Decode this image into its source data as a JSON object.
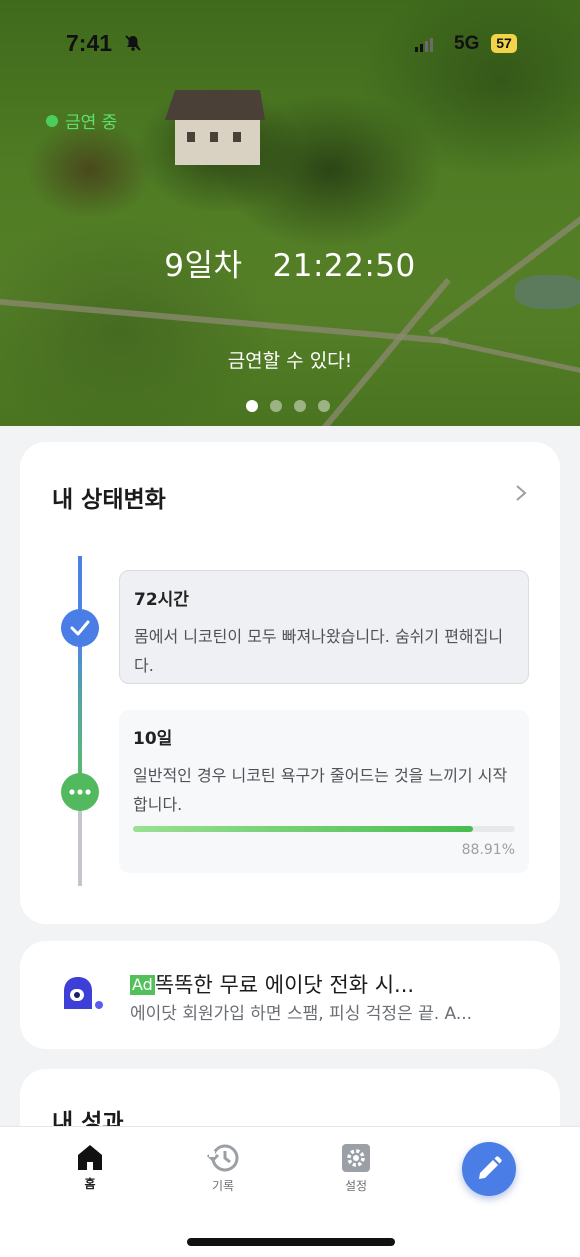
{
  "status_bar": {
    "time": "7:41",
    "network": "5G",
    "battery": "57"
  },
  "hero": {
    "quit_status": "금연 중",
    "day_label": "9일차",
    "elapsed_time": "21:22:50",
    "motto": "금연할 수 있다!",
    "page_dots": {
      "count": 4,
      "active": 1
    }
  },
  "status_card": {
    "title": "내 상태변화",
    "stages": [
      {
        "title": "72시간",
        "description": "몸에서 니코틴이 모두 빠져나왔습니다. 숨쉬기 편해집니다.",
        "state": "done"
      },
      {
        "title": "10일",
        "description": "일반적인 경우 니코틴 욕구가 줄어드는 것을 느끼기 시작합니다.",
        "state": "in-progress",
        "progress": 88.91,
        "progress_label": "88.91%"
      }
    ]
  },
  "ad": {
    "badge": "Ad",
    "title": "똑똑한 무료 에이닷 전화 시...",
    "description": "에이닷 회원가입 하면 스팸, 피싱 걱정은 끝. A..."
  },
  "results_card": {
    "title": "내 성과"
  },
  "tab_bar": {
    "tabs": [
      {
        "label": "홈",
        "icon": "home-icon",
        "active": true
      },
      {
        "label": "기록",
        "icon": "history-icon",
        "active": false
      },
      {
        "label": "설정",
        "icon": "gear-icon",
        "active": false
      }
    ],
    "fab_icon": "pencil-icon"
  },
  "colors": {
    "accent": "#4a7ee6",
    "success": "#53b95f",
    "quit_dot": "#4ccf5a"
  }
}
